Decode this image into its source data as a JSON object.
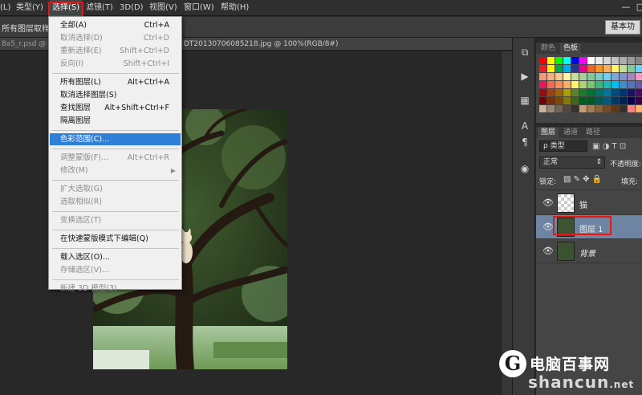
{
  "menubar": {
    "items": [
      {
        "label": "(L)"
      },
      {
        "label": "类型(Y)"
      },
      {
        "label": "选择(S)"
      },
      {
        "label": "滤镜(T)"
      },
      {
        "label": "3D(D)"
      },
      {
        "label": "视图(V)"
      },
      {
        "label": "窗口(W)"
      },
      {
        "label": "帮助(H)"
      }
    ],
    "active_index": 2,
    "window_buttons": {
      "minimize": "—",
      "restore": "□"
    }
  },
  "options_bar": {
    "left_text": "所有图层取样",
    "workspace_button": "基本功"
  },
  "document_tabs": [
    {
      "label": "8a5_r.psd @ 33"
    },
    {
      "label": "DT20130706085218.jpg @ 100%(RGB/8#)"
    }
  ],
  "select_menu": {
    "items": [
      {
        "label": "全部(A)",
        "shortcut": "Ctrl+A",
        "enabled": true
      },
      {
        "label": "取消选择(D)",
        "shortcut": "Ctrl+D",
        "enabled": false
      },
      {
        "label": "重新选择(E)",
        "shortcut": "Shift+Ctrl+D",
        "enabled": false
      },
      {
        "label": "反向(I)",
        "shortcut": "Shift+Ctrl+I",
        "enabled": false
      },
      {
        "separator": true
      },
      {
        "label": "所有图层(L)",
        "shortcut": "Alt+Ctrl+A",
        "enabled": true
      },
      {
        "label": "取消选择图层(S)",
        "shortcut": "",
        "enabled": true
      },
      {
        "label": "查找图层",
        "shortcut": "Alt+Shift+Ctrl+F",
        "enabled": true
      },
      {
        "label": "隔离图层",
        "shortcut": "",
        "enabled": true
      },
      {
        "separator": true
      },
      {
        "label": "色彩范围(C)...",
        "shortcut": "",
        "enabled": true,
        "highlighted": true
      },
      {
        "separator": true
      },
      {
        "label": "调整蒙版(F)...",
        "shortcut": "Alt+Ctrl+R",
        "enabled": false
      },
      {
        "label": "修改(M)",
        "shortcut": "",
        "enabled": false,
        "submenu": true
      },
      {
        "separator": true
      },
      {
        "label": "扩大选取(G)",
        "shortcut": "",
        "enabled": false
      },
      {
        "label": "选取相似(R)",
        "shortcut": "",
        "enabled": false
      },
      {
        "separator": true
      },
      {
        "label": "变换选区(T)",
        "shortcut": "",
        "enabled": false
      },
      {
        "separator": true
      },
      {
        "label": "在快速蒙版模式下编辑(Q)",
        "shortcut": "",
        "enabled": true
      },
      {
        "separator": true
      },
      {
        "label": "载入选区(O)...",
        "shortcut": "",
        "enabled": true
      },
      {
        "label": "存储选区(V)...",
        "shortcut": "",
        "enabled": false
      },
      {
        "separator": true
      },
      {
        "label": "新建 3D 模型(3)",
        "shortcut": "",
        "enabled": false
      }
    ],
    "submenu_arrow": "▶"
  },
  "swatches_panel": {
    "tabs": [
      "颜色",
      "色板"
    ],
    "active_tab": 1,
    "colors": [
      [
        "#ff0000",
        "#ffff00",
        "#00ff00",
        "#00ffff",
        "#0000ff",
        "#ff00ff",
        "#ffffff",
        "#ebebeb",
        "#d6d6d6",
        "#c2c2c2",
        "#adadad",
        "#999999",
        "#858585"
      ],
      [
        "#ed1c24",
        "#fff200",
        "#00a651",
        "#00aeef",
        "#2e3192",
        "#ec008c",
        "#f26522",
        "#f7941d",
        "#fbaf5d",
        "#fff568",
        "#c4df9b",
        "#82ca9c",
        "#6dcff6"
      ],
      [
        "#f7977a",
        "#f9ad81",
        "#fdc68a",
        "#fff79a",
        "#c4df9b",
        "#a3d39c",
        "#82ca9c",
        "#7accc8",
        "#6dcff6",
        "#7da7d9",
        "#8493ca",
        "#a187be",
        "#f49ac1"
      ],
      [
        "#ed145b",
        "#f26c4f",
        "#f68e56",
        "#fbaf5d",
        "#fff467",
        "#acd373",
        "#7cc576",
        "#3bb878",
        "#1abbb4",
        "#00bff3",
        "#438ccb",
        "#5574b9",
        "#605ca8"
      ],
      [
        "#9e0b0f",
        "#a0410d",
        "#a3620a",
        "#aba000",
        "#598527",
        "#1a7b30",
        "#007236",
        "#00746b",
        "#0076a3",
        "#004b80",
        "#003471",
        "#1b1464",
        "#440e62"
      ],
      [
        "#790000",
        "#7b2e00",
        "#7d4900",
        "#827b00",
        "#406618",
        "#005e20",
        "#005826",
        "#005952",
        "#005b7f",
        "#003663",
        "#002157",
        "#0d004c",
        "#32004b"
      ],
      [
        "#c7b299",
        "#998675",
        "#736357",
        "#534741",
        "#37302d",
        "#c69c6d",
        "#a67c52",
        "#8c6239",
        "#754c24",
        "#603913",
        "#362f2d",
        "#ff8080",
        "#ffb366"
      ]
    ]
  },
  "layers_panel": {
    "tabs": [
      "图层",
      "通道",
      "路径"
    ],
    "active_tab": 0,
    "filter_label": "ρ 类型",
    "blend_mode": "正常",
    "opacity_label": "不透明度:",
    "lock_label": "锁定:",
    "fill_label": "填充:",
    "layers": [
      {
        "name": "猫",
        "visible": true,
        "selected": false
      },
      {
        "name": "图层 1",
        "visible": true,
        "selected": true
      },
      {
        "name": "背景",
        "visible": true,
        "selected": false
      }
    ]
  },
  "tool_strip": {
    "icons": [
      "history-icon",
      "play-icon",
      "properties-icon",
      "character-icon",
      "paragraph-icon",
      "brush-preset-icon"
    ]
  },
  "watermark": {
    "logo_letter": "G",
    "cn_text": "电脑百事网",
    "en_text": "shancun",
    "tld_text": ".net"
  }
}
